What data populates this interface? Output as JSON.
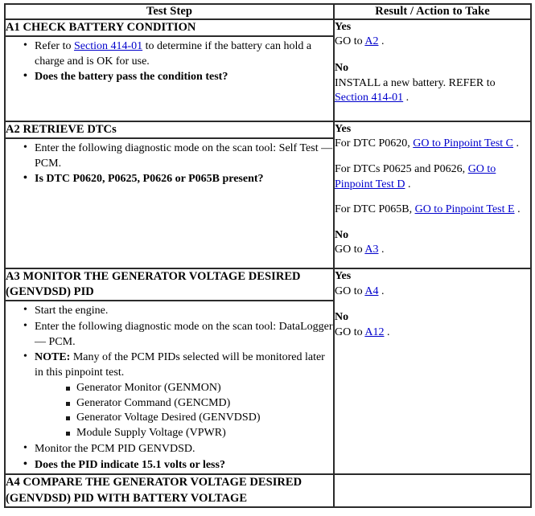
{
  "table": {
    "headers": {
      "step": "Test Step",
      "result": "Result / Action to Take"
    },
    "steps": [
      {
        "id": "A1",
        "title": "A1 CHECK BATTERY CONDITION",
        "bullets": {
          "b1_pre": "Refer to ",
          "b1_link": "Section 414-01",
          "b1_post": " to determine if the battery can hold a charge and is OK for use.",
          "b2": "Does the battery pass the condition test?"
        },
        "result": {
          "yes_label": "Yes",
          "yes_pre": "GO to ",
          "yes_link": "A2",
          "yes_post": " .",
          "no_label": "No",
          "no_pre": "INSTALL a new battery. REFER to ",
          "no_link": "Section 414-01",
          "no_post": " ."
        }
      },
      {
        "id": "A2",
        "title": "A2 RETRIEVE DTCs",
        "bullets": {
          "b1": "Enter the following diagnostic mode on the scan tool: Self Test — PCM.",
          "b2": "Is DTC P0620, P0625, P0626 or P065B present?"
        },
        "result": {
          "yes_label": "Yes",
          "line1_pre": "For DTC P0620, ",
          "line1_link": "GO to Pinpoint Test C",
          "line1_post": " .",
          "line2_pre": "For DTCs P0625 and P0626, ",
          "line2_link": "GO to Pinpoint Test D",
          "line2_post": " .",
          "line3_pre": "For DTC P065B, ",
          "line3_link": "GO to Pinpoint Test E",
          "line3_post": " .",
          "no_label": "No",
          "no_pre": "GO to ",
          "no_link": "A3",
          "no_post": " ."
        }
      },
      {
        "id": "A3",
        "title": "A3 MONITOR THE GENERATOR VOLTAGE DESIRED (GENVDSD) PID",
        "bullets": {
          "b1": "Start the engine.",
          "b2": "Enter the following diagnostic mode on the scan tool: DataLogger — PCM.",
          "b3_bold": "NOTE:",
          "b3_rest": " Many of the PCM PIDs selected will be monitored later in this pinpoint test.",
          "sub": [
            "Generator Monitor (GENMON)",
            "Generator Command (GENCMD)",
            "Generator Voltage Desired (GENVDSD)",
            "Module Supply Voltage (VPWR)"
          ],
          "b4": "Monitor the PCM PID GENVDSD.",
          "b5": "Does the PID indicate 15.1 volts or less?"
        },
        "result": {
          "yes_label": "Yes",
          "yes_pre": "GO to ",
          "yes_link": "A4",
          "yes_post": " .",
          "no_label": "No",
          "no_pre": "GO to ",
          "no_link": "A12",
          "no_post": " ."
        }
      },
      {
        "id": "A4",
        "title": "A4 COMPARE THE GENERATOR VOLTAGE DESIRED (GENVDSD) PID WITH BATTERY VOLTAGE"
      }
    ]
  },
  "colors": {
    "link": "#0000cc",
    "border": "#2b2b2b",
    "text": "#000000",
    "background": "#ffffff"
  }
}
